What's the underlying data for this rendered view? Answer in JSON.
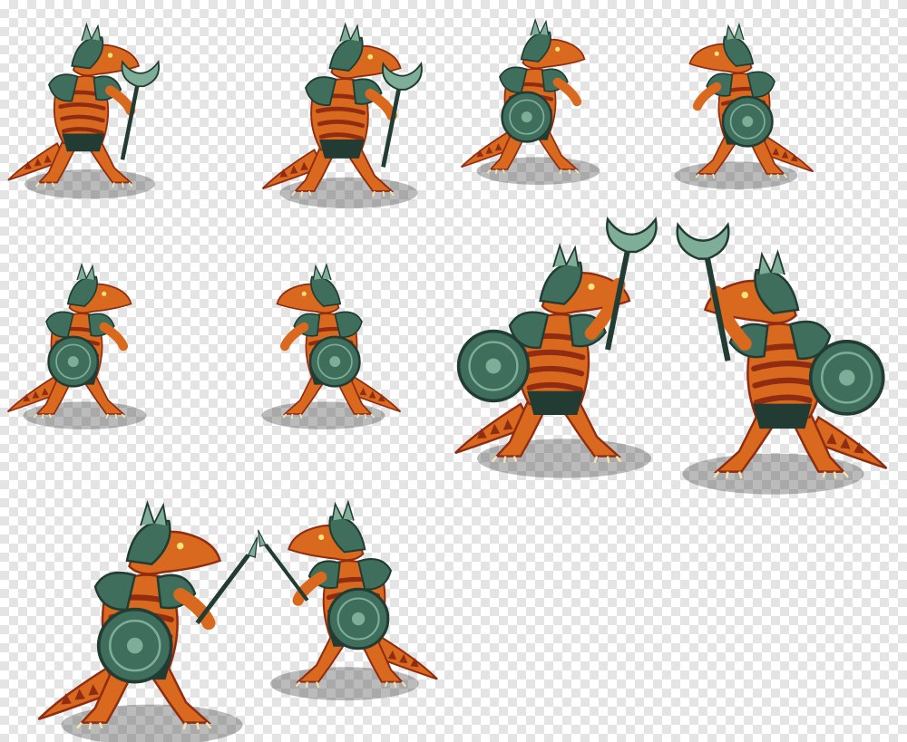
{
  "sprite_sheet": {
    "subject": "lizardman-warrior",
    "frame_count": 10,
    "frames": [
      {
        "id": "frame-1",
        "pose": "crouch-axe-low",
        "facing": "right",
        "flip": false,
        "weapon": "axe",
        "shield": false,
        "axe_raised": false
      },
      {
        "id": "frame-2",
        "pose": "guard-axe-up",
        "facing": "right",
        "flip": false,
        "weapon": "axe",
        "shield": false,
        "axe_raised": false
      },
      {
        "id": "frame-3",
        "pose": "back-shield",
        "facing": "away-right",
        "flip": false,
        "weapon": "none",
        "shield": true,
        "axe_raised": false
      },
      {
        "id": "frame-4",
        "pose": "back-shield",
        "facing": "away-left",
        "flip": true,
        "weapon": "none",
        "shield": true,
        "axe_raised": false
      },
      {
        "id": "frame-5",
        "pose": "back-shield-raise",
        "facing": "away-right",
        "flip": false,
        "weapon": "none",
        "shield": true,
        "axe_raised": false
      },
      {
        "id": "frame-6",
        "pose": "back-shield-raise",
        "facing": "away-left",
        "flip": true,
        "weapon": "none",
        "shield": true,
        "axe_raised": false
      },
      {
        "id": "frame-7",
        "pose": "attack-axe-overhead",
        "facing": "right",
        "flip": false,
        "weapon": "axe",
        "shield": true,
        "axe_raised": true
      },
      {
        "id": "frame-8",
        "pose": "attack-axe-overhead",
        "facing": "left",
        "flip": true,
        "weapon": "axe",
        "shield": true,
        "axe_raised": true
      },
      {
        "id": "frame-9",
        "pose": "throw-wind-up",
        "facing": "right",
        "flip": false,
        "weapon": "spear",
        "shield": true,
        "axe_raised": false
      },
      {
        "id": "frame-10",
        "pose": "shield-block",
        "facing": "left",
        "flip": true,
        "weapon": "spear",
        "shield": true,
        "axe_raised": false
      }
    ]
  },
  "colors": {
    "skin_orange": "#d9691e",
    "skin_stripe": "#8f2c12",
    "skin_light": "#f0a050",
    "armor": "#3f6f5c",
    "armor_light": "#7fae98",
    "armor_dark": "#223c33",
    "shadow": "rgba(60,60,60,0.35)",
    "claw": "#f3e6b0"
  }
}
